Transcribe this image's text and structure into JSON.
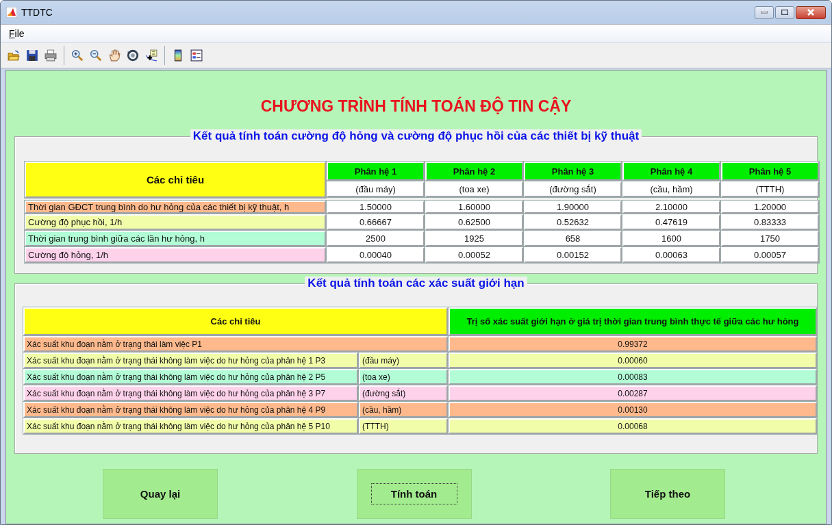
{
  "window": {
    "title": "TTDTC"
  },
  "menu": [
    {
      "label": "File"
    }
  ],
  "heading": "CHƯƠNG TRÌNH TÍNH TOÁN ĐỘ TIN CẬY",
  "failure_panel": {
    "title": "Kết quả tính toán cường độ hỏng và cường độ phục hồi của các thiết bị kỹ thuật",
    "corner_header": "Các chỉ tiêu",
    "columns": [
      {
        "name": "Phân hệ 1",
        "subtitle": "(đầu máy)"
      },
      {
        "name": "Phân hệ 2",
        "subtitle": "(toa xe)"
      },
      {
        "name": "Phân hệ 3",
        "subtitle": "(đường sắt)"
      },
      {
        "name": "Phân hệ 4",
        "subtitle": "(cầu, hầm)"
      },
      {
        "name": "Phân hệ 5",
        "subtitle": "(TTTH)"
      }
    ],
    "rows": [
      {
        "label": "Thời gian GĐCT trung bình do hư hỏng của các thiết bị kỹ thuật, h",
        "color": "#ffb98c",
        "values": [
          "1.50000",
          "1.60000",
          "1.90000",
          "2.10000",
          "1.20000"
        ]
      },
      {
        "label": "Cường độ phục hồi, 1/h",
        "color": "#f2fdaa",
        "values": [
          "0.66667",
          "0.62500",
          "0.52632",
          "0.47619",
          "0.83333"
        ]
      },
      {
        "label": "Thời gian trung bình giữa các lần hư hỏng, h",
        "color": "#b2fdd6",
        "values": [
          "2500",
          "1925",
          "658",
          "1600",
          "1750"
        ]
      },
      {
        "label": "Cường độ hỏng, 1/h",
        "color": "#ffd2ec",
        "values": [
          "0.00040",
          "0.00052",
          "0.00152",
          "0.00063",
          "0.00057"
        ]
      }
    ]
  },
  "probability_panel": {
    "title": "Kết quả tính toán các xác suất giới hạn",
    "corner_header": "Các chỉ tiêu",
    "value_header": "Trị số xác suất giới hạn ở giá trị thời gian trung bình thực tế giữa các hư hỏng",
    "rows": [
      {
        "label": "Xác suất khu đoạn nằm ở trạng thái làm việc P1",
        "value": "0.99372",
        "color": "#ffb98c"
      },
      {
        "label": "Xác suất khu đoạn nằm ở trạng thái không làm việc do hư hỏng của phân hệ 1 P3",
        "subsystem": "(đầu máy)",
        "value": "0.00060",
        "color": "#f2fdaa"
      },
      {
        "label": "Xác suất khu đoạn nằm ở trạng thái không làm việc do hư hỏng của phân hệ 2 P5",
        "subsystem": "(toa xe)",
        "value": "0.00083",
        "color": "#b2fdd6"
      },
      {
        "label": "Xác suất khu đoạn nằm ở trạng thái không làm việc do hư hỏng của phân hệ 3 P7",
        "subsystem": "(đường sắt)",
        "value": "0.00287",
        "color": "#ffd2ec"
      },
      {
        "label": "Xác suất khu đoạn nằm ở trạng thái không làm việc do hư hỏng của phân hệ 4 P9",
        "subsystem": "(cầu, hầm)",
        "value": "0.00130",
        "color": "#ffb98c"
      },
      {
        "label": "Xác suất khu đoạn nằm ở trạng thái không làm việc do hư hỏng của phân hệ 5 P10",
        "subsystem": "(TTTH)",
        "value": "0.00068",
        "color": "#f2fdaa"
      }
    ]
  },
  "buttons": [
    {
      "label": "Quay lại",
      "focused": false
    },
    {
      "label": "Tính toán",
      "focused": true
    },
    {
      "label": "Tiếp theo",
      "focused": false
    }
  ]
}
